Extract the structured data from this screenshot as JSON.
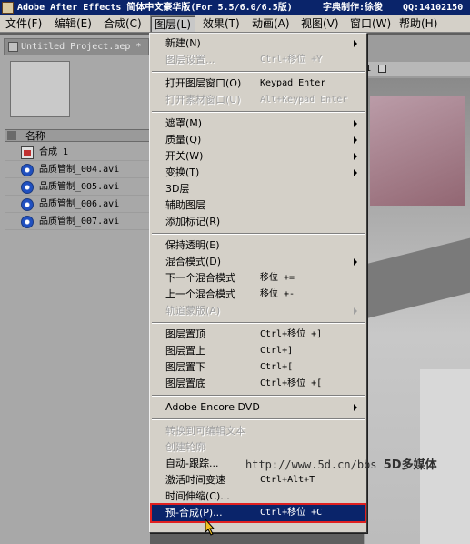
{
  "titlebar": {
    "title": "Adobe After Effects 简体中文豪华版(For 5.5/6.0/6.5版)",
    "author": "字典制作:徐俊",
    "qq": "QQ:14102150"
  },
  "menubar": [
    {
      "label": "文件(F)"
    },
    {
      "label": "编辑(E)"
    },
    {
      "label": "合成(C)"
    },
    {
      "label": "图层(L)"
    },
    {
      "label": "效果(T)"
    },
    {
      "label": "动画(A)"
    },
    {
      "label": "视图(V)"
    },
    {
      "label": "窗口(W)"
    },
    {
      "label": "帮助(H)"
    }
  ],
  "project": {
    "tab_title": "Untitled Project.aep *",
    "column_header": "名称",
    "items": [
      {
        "name": "合成 1",
        "icon": "composition-icon"
      },
      {
        "name": "品质管制_004.avi",
        "icon": "avi-file-icon"
      },
      {
        "name": "品质管制_005.avi",
        "icon": "avi-file-icon"
      },
      {
        "name": "品质管制_006.avi",
        "icon": "avi-file-icon"
      },
      {
        "name": "品质管制_007.avi",
        "icon": "avi-file-icon"
      }
    ]
  },
  "viewer": {
    "tab_label": "1"
  },
  "layer_menu": {
    "items": [
      {
        "label": "新建(N)",
        "shortcut": "",
        "submenu": true,
        "disabled": false
      },
      {
        "label": "图层设置...",
        "shortcut": "Ctrl+移位 +Y",
        "submenu": false,
        "disabled": true
      },
      {
        "separator": true
      },
      {
        "label": "打开图层窗口(O)",
        "shortcut": "Keypad Enter",
        "submenu": false,
        "disabled": false
      },
      {
        "label": "打开素材窗口(U)",
        "shortcut": "Alt+Keypad Enter",
        "submenu": false,
        "disabled": true
      },
      {
        "separator": true
      },
      {
        "label": "遮罩(M)",
        "shortcut": "",
        "submenu": true,
        "disabled": false
      },
      {
        "label": "质量(Q)",
        "shortcut": "",
        "submenu": true,
        "disabled": false
      },
      {
        "label": "开关(W)",
        "shortcut": "",
        "submenu": true,
        "disabled": false
      },
      {
        "label": "变换(T)",
        "shortcut": "",
        "submenu": true,
        "disabled": false
      },
      {
        "label": "3D层",
        "shortcut": "",
        "submenu": false,
        "disabled": false
      },
      {
        "label": "辅助图层",
        "shortcut": "",
        "submenu": false,
        "disabled": false
      },
      {
        "label": "添加标记(R)",
        "shortcut": "",
        "submenu": false,
        "disabled": false
      },
      {
        "separator": true
      },
      {
        "label": "保持透明(E)",
        "shortcut": "",
        "submenu": false,
        "disabled": false
      },
      {
        "label": "混合模式(D)",
        "shortcut": "",
        "submenu": true,
        "disabled": false
      },
      {
        "label": "下一个混合模式",
        "shortcut": "移位 +=",
        "submenu": false,
        "disabled": false
      },
      {
        "label": "上一个混合模式",
        "shortcut": "移位 +-",
        "submenu": false,
        "disabled": false
      },
      {
        "label": "轨道蒙版(A)",
        "shortcut": "",
        "submenu": true,
        "disabled": true
      },
      {
        "separator": true
      },
      {
        "label": "图层置顶",
        "shortcut": "Ctrl+移位 +]",
        "submenu": false,
        "disabled": false
      },
      {
        "label": "图层置上",
        "shortcut": "Ctrl+]",
        "submenu": false,
        "disabled": false
      },
      {
        "label": "图层置下",
        "shortcut": "Ctrl+[",
        "submenu": false,
        "disabled": false
      },
      {
        "label": "图层置底",
        "shortcut": "Ctrl+移位 +[",
        "submenu": false,
        "disabled": false
      },
      {
        "separator": true
      },
      {
        "label": "Adobe Encore DVD",
        "shortcut": "",
        "submenu": true,
        "disabled": false
      },
      {
        "separator": true
      },
      {
        "label": "转换到可编辑文本",
        "shortcut": "",
        "submenu": false,
        "disabled": true
      },
      {
        "label": "创建轮廓",
        "shortcut": "",
        "submenu": false,
        "disabled": true
      },
      {
        "label": "自动-跟踪...",
        "shortcut": "",
        "submenu": false,
        "disabled": false
      },
      {
        "label": "激活时间变速",
        "shortcut": "Ctrl+Alt+T",
        "submenu": false,
        "disabled": false
      },
      {
        "label": "时间伸缩(C)...",
        "shortcut": "",
        "submenu": false,
        "disabled": false
      },
      {
        "label": "预-合成(P)...",
        "shortcut": "Ctrl+移位 +C",
        "submenu": false,
        "disabled": false,
        "selected": true
      }
    ]
  },
  "watermark": {
    "url": "http://www.5d.cn/bbs",
    "text": "5D多媒体"
  },
  "colors": {
    "selection": "#0a246a",
    "highlight_box": "#e02020",
    "menu_bg": "#d4d0c8"
  }
}
